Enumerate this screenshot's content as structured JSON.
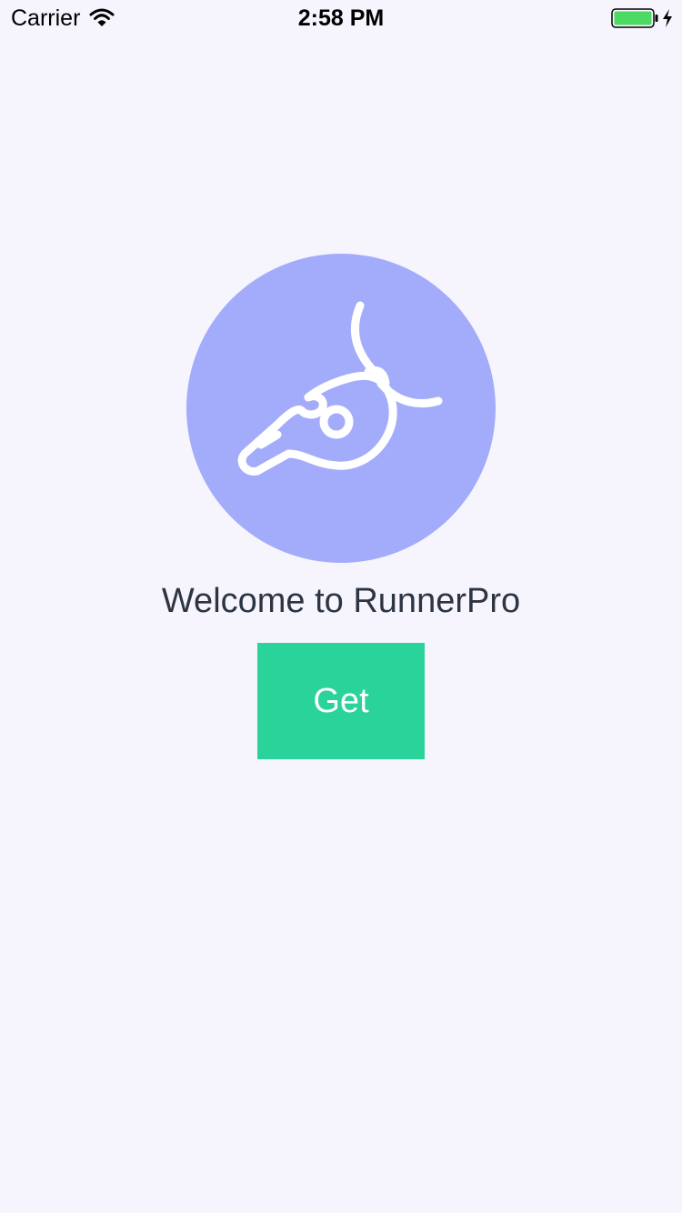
{
  "status_bar": {
    "carrier": "Carrier",
    "time": "2:58 PM",
    "battery_level": 1.0,
    "charging": true
  },
  "logo": {
    "icon": "whistle-icon",
    "background_color": "#A3ACFA"
  },
  "welcome": {
    "title": "Welcome to RunnerPro"
  },
  "actions": {
    "get_label": "Get",
    "button_color": "#2AD39A"
  },
  "colors": {
    "background": "#F6F5FE",
    "text": "#2D3442"
  }
}
